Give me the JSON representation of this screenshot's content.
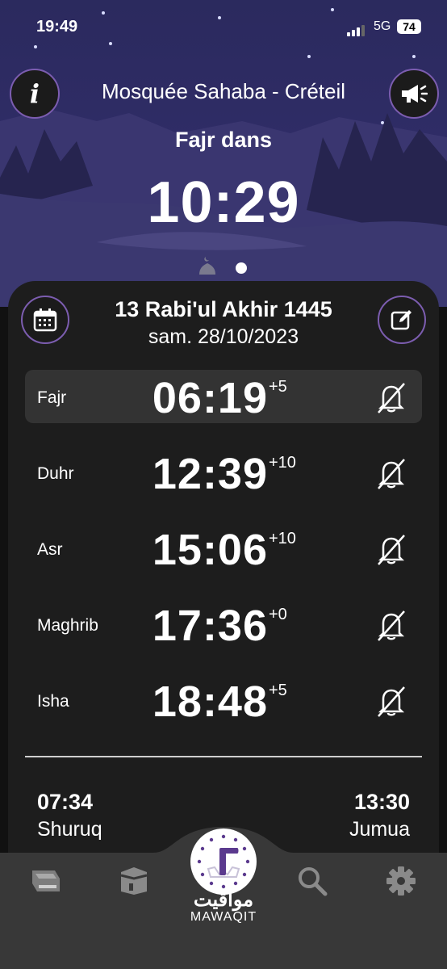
{
  "status_bar": {
    "time": "19:49",
    "network": "5G",
    "battery": "74"
  },
  "header": {
    "mosque_name": "Mosquée Sahaba - Créteil",
    "next_prayer_label": "Fajr dans",
    "countdown": "10:29"
  },
  "date": {
    "hijri": "13 Rabi'ul Akhir 1445",
    "gregorian": "sam. 28/10/2023"
  },
  "prayers": [
    {
      "name": "Fajr",
      "time": "06:19",
      "offset": "+5",
      "active": true
    },
    {
      "name": "Duhr",
      "time": "12:39",
      "offset": "+10",
      "active": false
    },
    {
      "name": "Asr",
      "time": "15:06",
      "offset": "+10",
      "active": false
    },
    {
      "name": "Maghrib",
      "time": "17:36",
      "offset": "+0",
      "active": false
    },
    {
      "name": "Isha",
      "time": "18:48",
      "offset": "+5",
      "active": false
    }
  ],
  "extra": {
    "shuruq": {
      "time": "07:34",
      "label": "Shuruq"
    },
    "jumua": {
      "time": "13:30",
      "label": "Jumua"
    }
  },
  "nav": {
    "items": [
      "quran-icon",
      "kaaba-icon",
      "mawaqit-logo",
      "search-icon",
      "settings-icon"
    ],
    "logo_arabic": "مواقيت",
    "logo_latin": "MAWAQIT"
  },
  "colors": {
    "accent": "#7c5db0",
    "card": "#1d1d1d",
    "active_row": "#333333",
    "nav": "#383838",
    "sky": "#2f2c66"
  }
}
